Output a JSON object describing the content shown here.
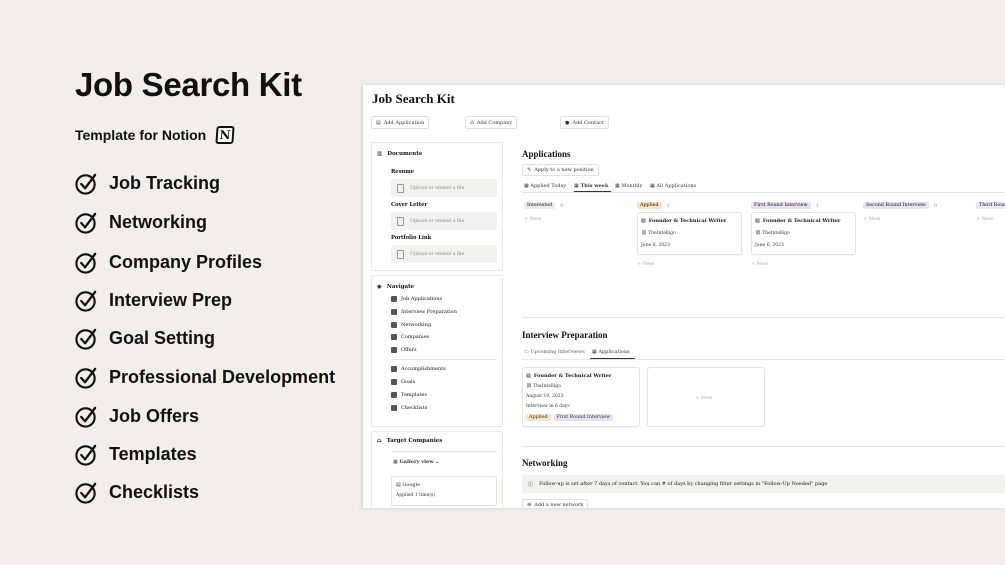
{
  "promo": {
    "title": "Job Search Kit",
    "subtitle": "Template for Notion",
    "features": [
      "Job Tracking",
      "Networking",
      "Company Profiles",
      "Interview Prep",
      "Goal Setting",
      "Professional Development",
      "Job Offers",
      "Templates",
      "Checklists"
    ]
  },
  "window": {
    "title": "Job Search Kit",
    "top_buttons": [
      "Add Application",
      "Add Company",
      "Add Contact"
    ],
    "documents": {
      "title": "Documents",
      "items": [
        {
          "label": "Resume",
          "placeholder": "Upload or embed a file"
        },
        {
          "label": "Cover Letter",
          "placeholder": "Upload or embed a file"
        },
        {
          "label": "Portfolio Link",
          "placeholder": "Upload or embed a file"
        }
      ]
    },
    "navigate": {
      "title": "Navigate",
      "group1": [
        "Job Applications",
        "Interview Preparation",
        "Networking",
        "Companies",
        "Offers"
      ],
      "group2": [
        "Accomplishments",
        "Goals",
        "Templates",
        "Checklists"
      ]
    },
    "target_companies": {
      "title": "Target Companies",
      "view": "Gallery view",
      "card_title": "Google",
      "card_sub": "Applied 1 time(s)"
    },
    "applications": {
      "title": "Applications",
      "apply_btn": "Apply to a new position",
      "tabs": [
        "Applied Today",
        "This week",
        "Monthly",
        "All Applications"
      ],
      "columns": [
        {
          "name": "Interested",
          "count": "0",
          "color": "#ebebe9"
        },
        {
          "name": "Applied",
          "count": "1",
          "color": "#fbe4c6"
        },
        {
          "name": "First Round Interview",
          "count": "1",
          "color": "#e8dff5"
        },
        {
          "name": "Second Round Interview",
          "count": "0",
          "color": "#e8e3f3"
        },
        {
          "name": "Third Round",
          "count": "",
          "color": "#ebe6f3"
        }
      ],
      "new_label": "New",
      "cards": [
        {
          "title": "Founder & Technical Writer",
          "company": "TheIntelligo",
          "date": "June 6, 2023"
        },
        {
          "title": "Founder & Technical Writer",
          "company": "TheIntelligo",
          "date": "June 6, 2023"
        }
      ]
    },
    "interview": {
      "title": "Interview Preparation",
      "tabs": [
        "Upcoming Interviews",
        "Applications"
      ],
      "card": {
        "title": "Founder & Technical Writer",
        "company": "TheIntelligo",
        "date": "August 10, 2023",
        "note": "Interview in 6 days",
        "tag1": "Applied",
        "tag2": "First Round Interview"
      },
      "new_label": "New"
    },
    "networking": {
      "title": "Networking",
      "callout": "Follow-up is set after 7 days of contact. You can # of days by changing filter settings in \"Follow-Up Needed\" page",
      "add_btn": "Add a new network"
    }
  }
}
